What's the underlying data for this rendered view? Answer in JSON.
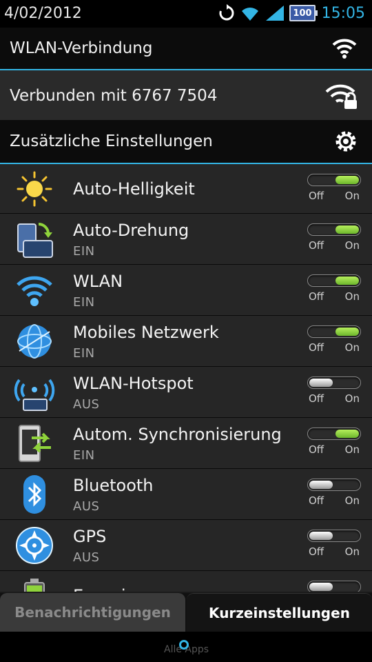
{
  "status_bar": {
    "date": "4/02/2012",
    "time": "15:05",
    "battery": "100",
    "accent_color": "#33b5e5",
    "icons": [
      "sync-icon",
      "wifi-icon",
      "signal-icon",
      "battery-icon"
    ]
  },
  "wlan": {
    "title": "WLAN-Verbindung",
    "connection": "Verbunden mit 6767 7504",
    "extra_settings": "Zusätzliche Einstellungen"
  },
  "items": [
    {
      "label": "Auto-Helligkeit",
      "sub": "",
      "on": true,
      "icon": "sun-icon"
    },
    {
      "label": "Auto-Drehung",
      "sub": "EIN",
      "on": true,
      "icon": "rotate-icon"
    },
    {
      "label": "WLAN",
      "sub": "EIN",
      "on": true,
      "icon": "wifi-icon"
    },
    {
      "label": "Mobiles Netzwerk",
      "sub": "EIN",
      "on": true,
      "icon": "globe-icon"
    },
    {
      "label": "WLAN-Hotspot",
      "sub": "AUS",
      "on": false,
      "icon": "hotspot-icon"
    },
    {
      "label": "Autom. Synchronisierung",
      "sub": "EIN",
      "on": true,
      "icon": "sync-phone-icon"
    },
    {
      "label": "Bluetooth",
      "sub": "AUS",
      "on": false,
      "icon": "bluetooth-icon"
    },
    {
      "label": "GPS",
      "sub": "AUS",
      "on": false,
      "icon": "gps-icon"
    },
    {
      "label": "Energie sparen",
      "sub": "",
      "on": false,
      "icon": "battery-saver-icon"
    }
  ],
  "toggle_labels": {
    "off": "Off",
    "on": "On"
  },
  "tabs": {
    "notifications": "Benachrichtigungen",
    "quick_settings": "Kurzeinstellungen"
  },
  "nav": {
    "hint": "Alle Apps"
  }
}
